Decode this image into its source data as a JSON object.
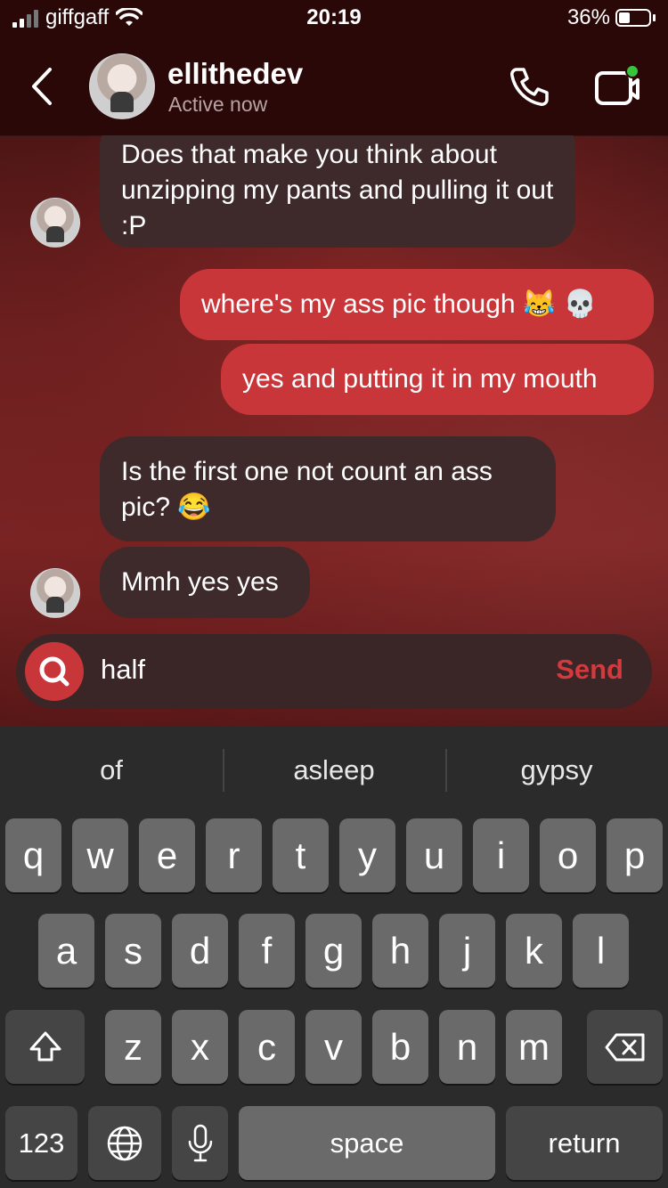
{
  "status_bar": {
    "carrier": "giffgaff",
    "time": "20:19",
    "battery": "36%"
  },
  "header": {
    "contact_name": "ellithedev",
    "contact_status": "Active now"
  },
  "messages": [
    {
      "from": "them",
      "text": "Does that make you think about unzipping my pants and pulling it out :P"
    },
    {
      "from": "me",
      "text": "where's my ass pic though 😹 💀"
    },
    {
      "from": "me",
      "text": "yes and putting it in my mouth"
    },
    {
      "from": "them",
      "text": "Is the first one not count an ass pic? 😂"
    },
    {
      "from": "them",
      "text": "Mmh yes yes"
    }
  ],
  "composer": {
    "input_value": "half",
    "send_label": "Send"
  },
  "keyboard": {
    "suggestions": [
      "of",
      "asleep",
      "gypsy"
    ],
    "row1": [
      "q",
      "w",
      "e",
      "r",
      "t",
      "y",
      "u",
      "i",
      "o",
      "p"
    ],
    "row2": [
      "a",
      "s",
      "d",
      "f",
      "g",
      "h",
      "j",
      "k",
      "l"
    ],
    "row3": [
      "z",
      "x",
      "c",
      "v",
      "b",
      "n",
      "m"
    ],
    "numbers_label": "123",
    "space_label": "space",
    "return_label": "return"
  }
}
